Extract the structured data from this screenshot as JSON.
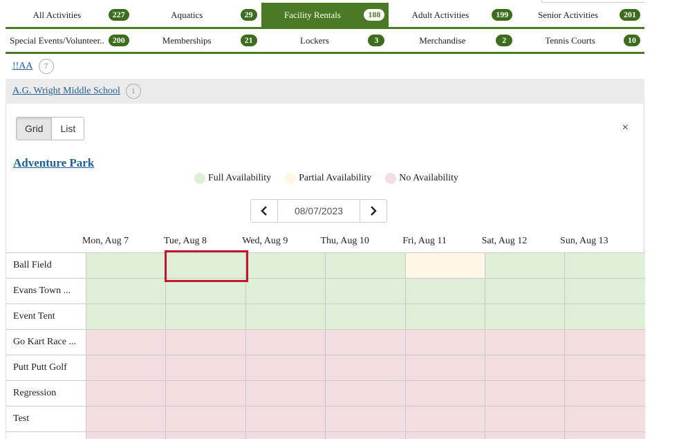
{
  "tabs_row1": [
    {
      "label": "All Activities",
      "count": "227",
      "active": false
    },
    {
      "label": "Aquatics",
      "count": "29",
      "active": false
    },
    {
      "label": "Facility Rentals",
      "count": "188",
      "active": true
    },
    {
      "label": "Adult Activities",
      "count": "199",
      "active": false
    },
    {
      "label": "Senior Activities",
      "count": "201",
      "active": false
    }
  ],
  "tabs_row2": [
    {
      "label": "Special Events/Volunteer..",
      "count": "200"
    },
    {
      "label": "Memberships",
      "count": "21"
    },
    {
      "label": "Lockers",
      "count": "3"
    },
    {
      "label": "Merchandise",
      "count": "2"
    },
    {
      "label": "Tennis Courts",
      "count": "10"
    }
  ],
  "facilities": [
    {
      "label": "!!AA",
      "count": "7"
    },
    {
      "label": "A.G. Wright Middle School",
      "count": "1"
    }
  ],
  "view_toggle": {
    "grid": "Grid",
    "list": "List"
  },
  "close_icon": "×",
  "park_title": "Adventure Park",
  "legend": [
    {
      "label": "Full Availability",
      "color": "#deeed7"
    },
    {
      "label": "Partial Availability",
      "color": "#fff7e6"
    },
    {
      "label": "No Availability",
      "color": "#f2dede"
    }
  ],
  "date_nav": {
    "value": "08/07/2023",
    "prev_icon": "chevron-left-icon",
    "next_icon": "chevron-right-icon"
  },
  "days": [
    "Mon, Aug 7",
    "Tue, Aug 8",
    "Wed, Aug 9",
    "Thu, Aug 10",
    "Fri, Aug 11",
    "Sat, Aug 12",
    "Sun, Aug 13"
  ],
  "rows": [
    {
      "name": "Ball Field",
      "cells": [
        "full",
        "full",
        "full",
        "full",
        "partial",
        "full",
        "full"
      ]
    },
    {
      "name": "Evans Town ...",
      "cells": [
        "full",
        "full",
        "full",
        "full",
        "full",
        "full",
        "full"
      ]
    },
    {
      "name": "Event Tent",
      "cells": [
        "full",
        "full",
        "full",
        "full",
        "full",
        "full",
        "full"
      ]
    },
    {
      "name": "Go Kart Race ...",
      "cells": [
        "none",
        "none",
        "none",
        "none",
        "none",
        "none",
        "none"
      ]
    },
    {
      "name": "Putt Putt Golf",
      "cells": [
        "none",
        "none",
        "none",
        "none",
        "none",
        "none",
        "none"
      ]
    },
    {
      "name": "Regression",
      "cells": [
        "none",
        "none",
        "none",
        "none",
        "none",
        "none",
        "none"
      ]
    },
    {
      "name": "Test",
      "cells": [
        "none",
        "none",
        "none",
        "none",
        "none",
        "none",
        "none"
      ]
    },
    {
      "name": "",
      "cells": [
        "none",
        "none",
        "none",
        "none",
        "none",
        "none",
        "none"
      ]
    }
  ]
}
